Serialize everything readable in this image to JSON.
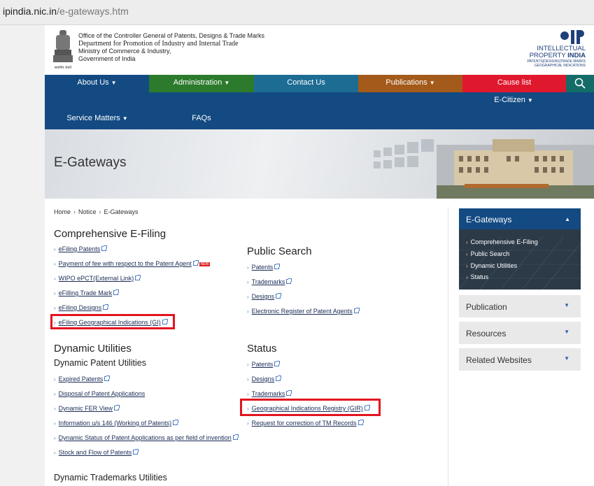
{
  "browser": {
    "url_host": "ipindia.nic.in",
    "url_path": "/e-gateways.htm"
  },
  "header": {
    "org_line1": "Office of the Controller General of Patents, Designs & Trade Marks",
    "org_line2": "Department for Promotion of Industry and Internal Trade",
    "org_line3": "Ministry of Commerce & Industry,",
    "org_line4": "Government of India",
    "emblem_motto": "सत्यमेव जयते",
    "logo_line1": "INTELLECTUAL",
    "logo_line2a": "PROPERTY",
    "logo_line2b": "INDIA",
    "logo_line3": "PATENTS|DESIGNS|TRADE MARKS",
    "logo_line4": "GEOGRAPHICAL INDICATIONS"
  },
  "nav": {
    "about": "About Us",
    "admin": "Administration",
    "contact": "Contact Us",
    "publications": "Publications",
    "cause": "Cause list",
    "ecitizen": "E-Citizen",
    "service": "Service Matters",
    "faq": "FAQs",
    "caret": "▼"
  },
  "banner": {
    "title": "E-Gateways"
  },
  "breadcrumb": {
    "home": "Home",
    "notice": "Notice",
    "current": "E-Gateways",
    "sep": "›"
  },
  "sections": {
    "efiling_title": "Comprehensive E-Filing",
    "efiling_links": [
      "eFiling Patents",
      "Payment of fee with respect to the Patent Agent",
      "WIPO ePCT(External Link)",
      "eFilling Trade Mark",
      "eFiling Designs",
      "eFiling Geographical Indications (GI)"
    ],
    "new_badge": "NEW",
    "public_title": "Public Search",
    "public_links": [
      "Patents",
      "Trademarks",
      "Designs",
      "Electronic Register of Patent Agents"
    ],
    "dynamic_title": "Dynamic Utilities",
    "dynamic_sub": "Dynamic Patent Utilities",
    "dynamic_links": [
      "Expired Patents",
      "Disposal of Patent Applications",
      "Dynamic FER View",
      "Information u/s 146 (Working of Patents)",
      "Dynamic Status of Patent Applications as per field of invention",
      "Stock and Flow of Patents"
    ],
    "status_title": "Status",
    "status_links": [
      "Patents",
      "Designs",
      "Trademarks",
      "Geographical Indications Registry (GIR)",
      "Request for correction of TM Records"
    ],
    "tm_utilities": "Dynamic Trademarks Utilities"
  },
  "sidebar": {
    "active_title": "E-Gateways",
    "active_links": [
      "Comprehensive E-Filing",
      "Public Search",
      "Dynamic Utilities",
      "Status"
    ],
    "boxes": [
      "Publication",
      "Resources",
      "Related Websites"
    ],
    "up": "▲",
    "down": "▼"
  },
  "colors": {
    "nav_blue": "#134a82",
    "admin_green": "#2c7a2c",
    "contact_teal": "#1d6c94",
    "pub_brown": "#a35a1a",
    "cause_red": "#e0182e",
    "highlight": "#e3141f"
  },
  "icons": [
    "search-icon",
    "external-link-icon",
    "chevron-right-icon",
    "caret-down-icon",
    "caret-up-icon",
    "emblem-icon",
    "ip-india-logo"
  ]
}
